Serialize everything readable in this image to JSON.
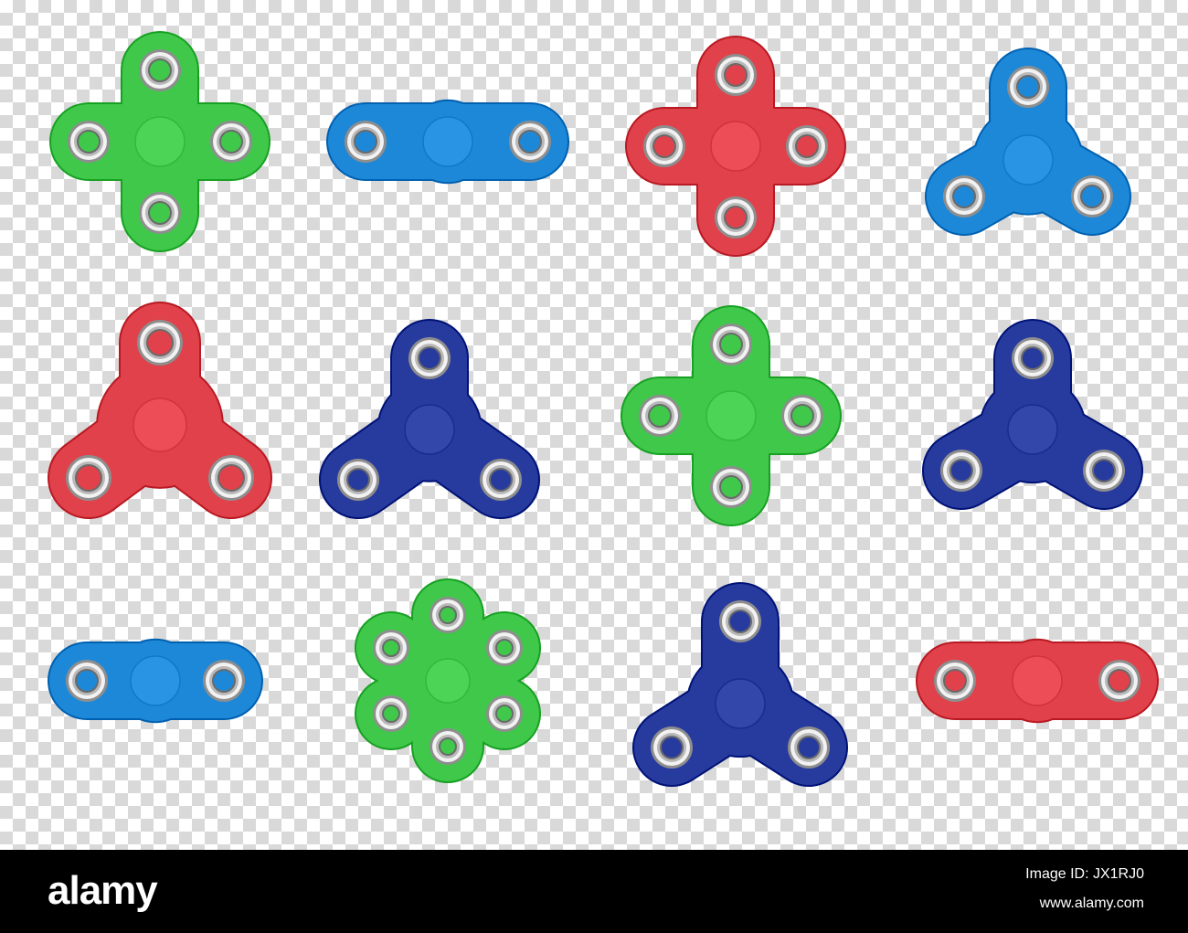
{
  "canvas": {
    "checker_dark": "#d9d9d9",
    "checker_light": "#ffffff"
  },
  "colors": {
    "green": "#3fc84a",
    "blue": "#1e88d8",
    "red": "#e0414a",
    "navy": "#273a9e",
    "bearing": "#b8b8b8"
  },
  "spinners": [
    {
      "name": "green-cross-spinner",
      "shape": "cross",
      "color": "green"
    },
    {
      "name": "blue-bar-spinner",
      "shape": "bar",
      "color": "blue"
    },
    {
      "name": "red-cross-spinner",
      "shape": "cross",
      "color": "red"
    },
    {
      "name": "blue-tri-spinner",
      "shape": "tri",
      "color": "blue"
    },
    {
      "name": "red-tri-spinner",
      "shape": "tri",
      "color": "red"
    },
    {
      "name": "navy-tri-spinner",
      "shape": "tri",
      "color": "navy"
    },
    {
      "name": "green-cross-spinner-2",
      "shape": "cross",
      "color": "green"
    },
    {
      "name": "navy-swirl-spinner",
      "shape": "tri",
      "color": "navy"
    },
    {
      "name": "blue-dual-spinner",
      "shape": "dual",
      "color": "blue"
    },
    {
      "name": "green-hex-spinner",
      "shape": "hex",
      "color": "green"
    },
    {
      "name": "navy-tri-spinner-2",
      "shape": "tri",
      "color": "navy"
    },
    {
      "name": "red-bar-spinner",
      "shape": "bar",
      "color": "red"
    }
  ],
  "footer": {
    "brand": "alamy",
    "image_id": "Image ID: JX1RJ0",
    "site": "www.alamy.com"
  }
}
